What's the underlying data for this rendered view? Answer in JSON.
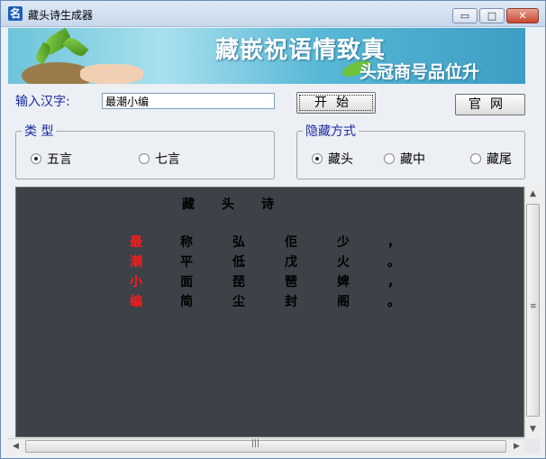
{
  "window": {
    "title": "藏头诗生成器",
    "icon_glyph": "名",
    "controls": {
      "minimize": "▭",
      "maximize": "□",
      "close": "✕"
    }
  },
  "banner": {
    "line1": "藏嵌祝语情致真",
    "line2": "头冠商号品位升"
  },
  "input": {
    "label": "输入汉字:",
    "value": "最潮小编"
  },
  "buttons": {
    "start": "开始",
    "website": "官网"
  },
  "type_group": {
    "legend": "类 型",
    "options": [
      "五言",
      "七言"
    ],
    "selected": "五言"
  },
  "hide_group": {
    "legend": "隐藏方式",
    "options": [
      "藏头",
      "藏中",
      "藏尾"
    ],
    "selected": "藏头"
  },
  "poem": {
    "title": "藏头诗",
    "lines": [
      {
        "head": "最",
        "rest": [
          "称",
          "弘",
          "佢",
          "少"
        ],
        "punct": "，"
      },
      {
        "head": "潮",
        "rest": [
          "平",
          "低",
          "戊",
          "火"
        ],
        "punct": "。"
      },
      {
        "head": "小",
        "rest": [
          "面",
          "琵",
          "琶",
          "婢"
        ],
        "punct": "，"
      },
      {
        "head": "编",
        "rest": [
          "简",
          "尘",
          "封",
          "阁"
        ],
        "punct": "。"
      }
    ]
  },
  "scroll": {
    "grip": "≡"
  },
  "colors": {
    "head_char": "#ff1a1a",
    "output_bg": "#3c4247",
    "label_blue": "#1a2aa0"
  }
}
